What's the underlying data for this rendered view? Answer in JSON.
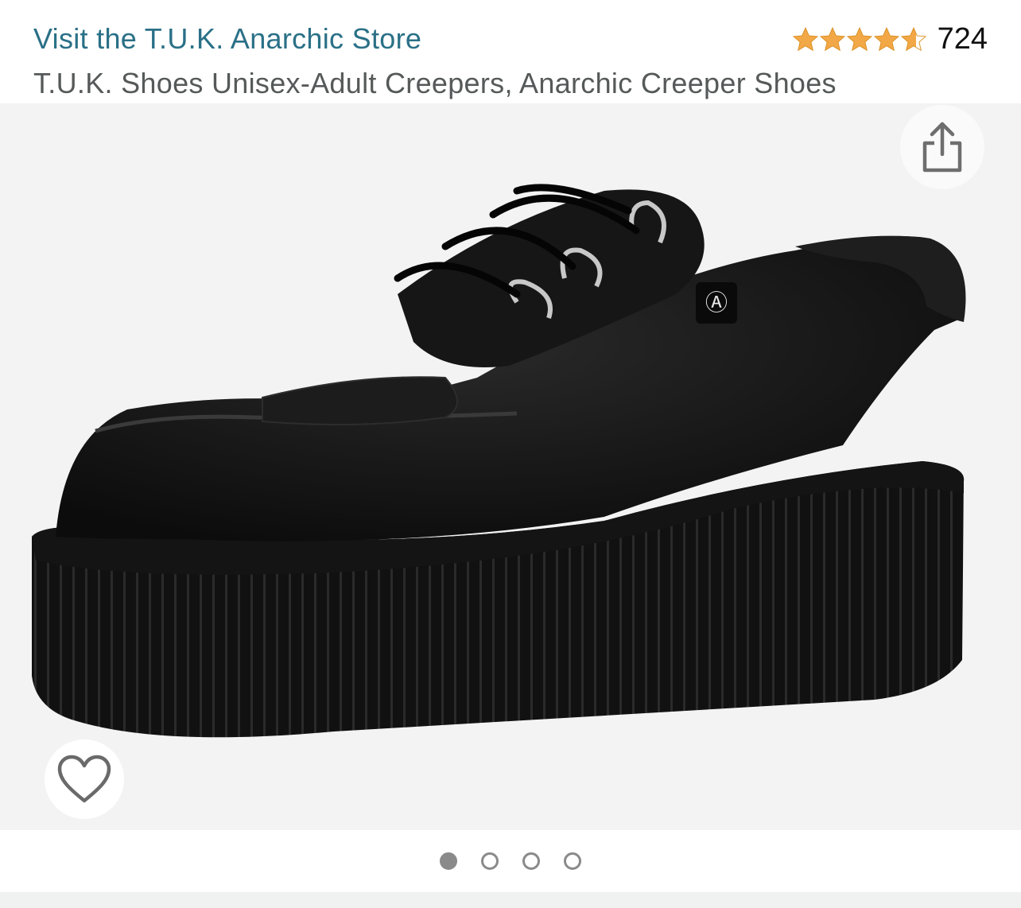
{
  "store": {
    "link_text": "Visit the T.U.K. Anarchic Store"
  },
  "rating": {
    "stars": 4.5,
    "count": "724",
    "star_color": "#f3a847"
  },
  "product": {
    "title": "T.U.K. Shoes Unisex-Adult Creepers, Anarchic Creeper Shoes"
  },
  "gallery": {
    "image_icon": "black-suede-creeper-shoe",
    "share_icon": "share-icon",
    "favorite_icon": "heart-icon",
    "dots_total": 4,
    "active_dot": 0
  },
  "colors": {
    "link": "#2a7087",
    "subtitle": "#565959",
    "gallery_bg": "#f3f3f3"
  }
}
